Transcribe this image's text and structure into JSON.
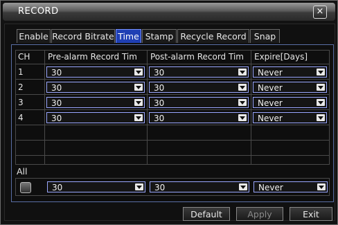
{
  "window": {
    "title": "RECORD",
    "close_label": "×"
  },
  "tabs": [
    {
      "label": "Enable",
      "active": false
    },
    {
      "label": "Record Bitrate",
      "active": false
    },
    {
      "label": "Time",
      "active": true
    },
    {
      "label": "Stamp",
      "active": false
    },
    {
      "label": "Recycle Record",
      "active": false
    },
    {
      "label": "Snap",
      "active": false
    }
  ],
  "table": {
    "headers": [
      "CH",
      "Pre-alarm Record Tim",
      "Post-alarm Record Tim",
      "Expire[Days]"
    ],
    "rows": [
      {
        "ch": "1",
        "pre": "30",
        "post": "30",
        "expire": "Never"
      },
      {
        "ch": "2",
        "pre": "30",
        "post": "30",
        "expire": "Never"
      },
      {
        "ch": "3",
        "pre": "30",
        "post": "30",
        "expire": "Never"
      },
      {
        "ch": "4",
        "pre": "30",
        "post": "30",
        "expire": "Never"
      }
    ]
  },
  "all": {
    "label": "All",
    "pre": "30",
    "post": "30",
    "expire": "Never"
  },
  "buttons": {
    "default": "Default",
    "apply": "Apply",
    "exit": "Exit"
  },
  "colors": {
    "active_tab": "#1f3fb4",
    "select_border": "#9aa7ff"
  }
}
